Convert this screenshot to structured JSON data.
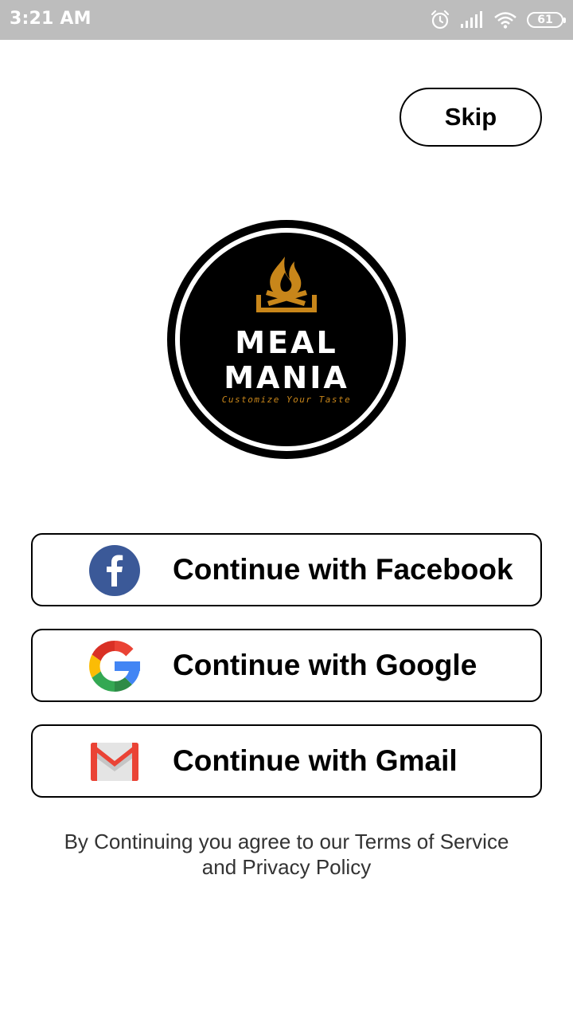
{
  "status_bar": {
    "time": "3:21 AM",
    "battery": "61",
    "icons": [
      "alarm-icon",
      "signal-icon",
      "wifi-icon",
      "battery-icon"
    ]
  },
  "skip_label": "Skip",
  "logo": {
    "line1": "MEAL",
    "line2": "MANIA",
    "tagline": "Customize Your Taste",
    "accent_color": "#c8861a"
  },
  "login_buttons": [
    {
      "label": "Continue with Facebook",
      "icon": "facebook-icon",
      "color": "#3b5998"
    },
    {
      "label": "Continue with Google",
      "icon": "google-icon"
    },
    {
      "label": "Continue with Gmail",
      "icon": "gmail-icon",
      "color": "#ea4335"
    }
  ],
  "terms": {
    "line1": "By Continuing you agree to our Terms of Service",
    "line2": "and Privacy Policy"
  }
}
